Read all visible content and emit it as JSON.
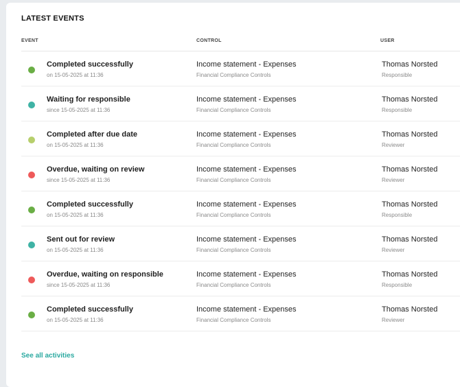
{
  "panel": {
    "title": "LATEST EVENTS",
    "columns": {
      "event": "EVENT",
      "control": "CONTROL",
      "user": "USER"
    },
    "see_all": "See all activities"
  },
  "status_colors": {
    "completed": "#6aae45",
    "waiting": "#3fb3a5",
    "late": "#b7cf6c",
    "overdue": "#ee5a5a"
  },
  "events": [
    {
      "status": "completed",
      "title": "Completed successfully",
      "sub": "on 15-05-2025 at 11:36",
      "control": "Income statement - Expenses",
      "control_sub": "Financial Compliance Controls",
      "user": "Thomas Norsted",
      "role": "Responsible"
    },
    {
      "status": "waiting",
      "title": "Waiting for responsible",
      "sub": "since 15-05-2025 at 11:36",
      "control": "Income statement - Expenses",
      "control_sub": "Financial Compliance Controls",
      "user": "Thomas Norsted",
      "role": "Responsible"
    },
    {
      "status": "late",
      "title": "Completed after due date",
      "sub": "on 15-05-2025 at 11:36",
      "control": "Income statement - Expenses",
      "control_sub": "Financial Compliance Controls",
      "user": "Thomas Norsted",
      "role": "Reviewer"
    },
    {
      "status": "overdue",
      "title": "Overdue, waiting on review",
      "sub": "since 15-05-2025 at 11:36",
      "control": "Income statement - Expenses",
      "control_sub": "Financial Compliance Controls",
      "user": "Thomas Norsted",
      "role": "Reviewer"
    },
    {
      "status": "completed",
      "title": "Completed successfully",
      "sub": "on 15-05-2025 at 11:36",
      "control": "Income statement - Expenses",
      "control_sub": "Financial Compliance Controls",
      "user": "Thomas Norsted",
      "role": "Responsible"
    },
    {
      "status": "waiting",
      "title": "Sent out for review",
      "sub": "on 15-05-2025 at 11:36",
      "control": "Income statement - Expenses",
      "control_sub": "Financial Compliance Controls",
      "user": "Thomas Norsted",
      "role": "Reviewer"
    },
    {
      "status": "overdue",
      "title": "Overdue, waiting on responsible",
      "sub": "since 15-05-2025 at 11:36",
      "control": "Income statement - Expenses",
      "control_sub": "Financial Compliance Controls",
      "user": "Thomas Norsted",
      "role": "Responsible"
    },
    {
      "status": "completed",
      "title": "Completed successfully",
      "sub": "on 15-05-2025 at 11:36",
      "control": "Income statement - Expenses",
      "control_sub": "Financial Compliance Controls",
      "user": "Thomas Norsted",
      "role": "Reviewer"
    }
  ]
}
